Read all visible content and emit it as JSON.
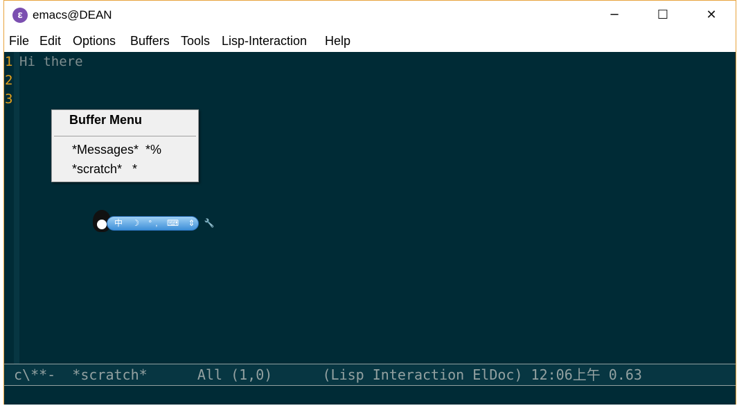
{
  "window": {
    "title": "emacs@DEAN",
    "app_icon": "emacs-icon",
    "controls": {
      "minimize": "─",
      "maximize": "☐",
      "close": "✕"
    }
  },
  "menubar": [
    "File",
    "Edit",
    "Options",
    "Buffers",
    "Tools",
    "Lisp-Interaction",
    "Help"
  ],
  "editor": {
    "line_numbers": [
      "1",
      "2",
      "3"
    ],
    "content": "Hi there"
  },
  "buffer_menu": {
    "title": "Buffer Menu",
    "items": [
      "*Messages*  *%",
      "*scratch*   *"
    ]
  },
  "ime_toolbar": {
    "label": "中 ☽ °, ⌨ ⇕ 🔧"
  },
  "modeline": {
    "text": "c\\**-  *scratch*      All (1,0)      (Lisp Interaction ElDoc) 12:06上午 0.63"
  },
  "colors": {
    "background": "#002b36",
    "line_numbers": "#e5a11c",
    "text": "#7f8e8f",
    "modeline": "#073642"
  }
}
